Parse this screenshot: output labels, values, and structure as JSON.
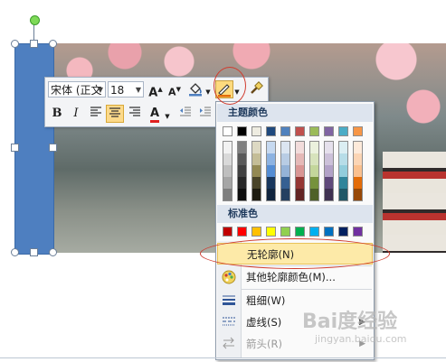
{
  "toolbar": {
    "font_name": "宋体 (正文",
    "font_size": "18",
    "bold": "B",
    "italic": "I",
    "font_color_letter": "A",
    "grow_font": "A",
    "shrink_font": "A"
  },
  "colors": {
    "shape_fill": "#4e7fc0",
    "highlight": "#fdeaa8",
    "annotation": "#d03c2f"
  },
  "menu": {
    "theme_colors_label": "主题颜色",
    "standard_colors_label": "标准色",
    "theme_top_row": [
      "#ffffff",
      "#000000",
      "#eeece1",
      "#1f497d",
      "#4f81bd",
      "#c0504d",
      "#9bbb59",
      "#8064a2",
      "#4bacc6",
      "#f79646"
    ],
    "theme_shades": [
      [
        "#f2f2f2",
        "#d9d9d9",
        "#bfbfbf",
        "#a6a6a6",
        "#7f7f7f"
      ],
      [
        "#7f7f7f",
        "#595959",
        "#404040",
        "#262626",
        "#0d0d0d"
      ],
      [
        "#ddd9c3",
        "#c4bd97",
        "#938953",
        "#494429",
        "#1d1b10"
      ],
      [
        "#c6d9f0",
        "#8db3e2",
        "#548dd4",
        "#17365d",
        "#0f243e"
      ],
      [
        "#dbe5f1",
        "#b8cce4",
        "#95b3d7",
        "#366092",
        "#244061"
      ],
      [
        "#f2dcdb",
        "#e5b9b7",
        "#d99694",
        "#953734",
        "#632423"
      ],
      [
        "#ebf1dd",
        "#d7e3bc",
        "#c3d69b",
        "#76923c",
        "#4f6128"
      ],
      [
        "#e5e0ec",
        "#ccc1d9",
        "#b2a2c7",
        "#5f497a",
        "#3f3151"
      ],
      [
        "#dbeef3",
        "#b7dde8",
        "#92cddc",
        "#31859b",
        "#205867"
      ],
      [
        "#fdeada",
        "#fbd5b5",
        "#fac08f",
        "#e36c09",
        "#974806"
      ]
    ],
    "standard_row": [
      "#c00000",
      "#ff0000",
      "#ffc000",
      "#ffff00",
      "#92d050",
      "#00b050",
      "#00b0f0",
      "#0070c0",
      "#002060",
      "#7030a0"
    ],
    "items": [
      {
        "label": "无轮廓(N)",
        "icon": "no-outline-icon"
      },
      {
        "label": "其他轮廓颜色(M)...",
        "icon": "palette-icon"
      },
      {
        "label": "粗细(W)",
        "icon": "line-weight-icon"
      },
      {
        "label": "虚线(S)",
        "icon": "dash-icon"
      },
      {
        "label": "箭头(R)",
        "icon": "arrow-style-icon"
      }
    ]
  },
  "watermark": {
    "brand": "Bai度经验",
    "url": "jingyan.baidu.com"
  }
}
